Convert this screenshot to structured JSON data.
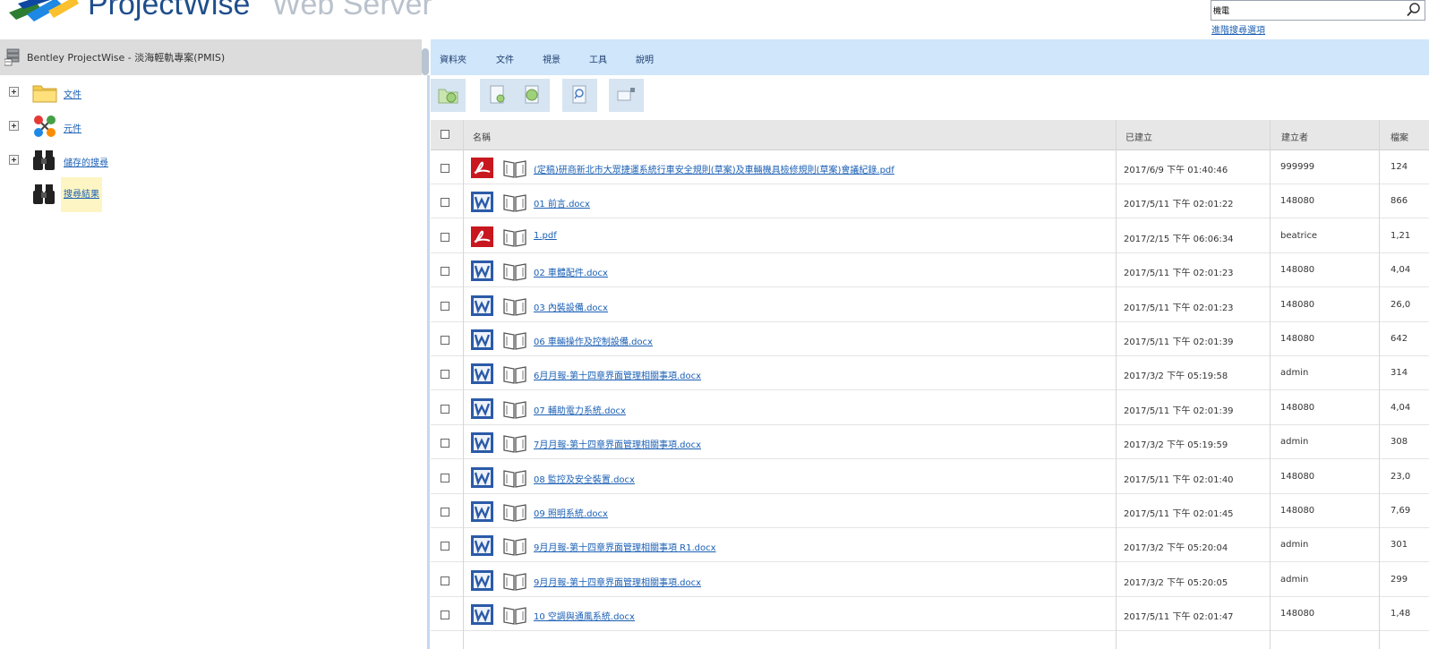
{
  "header": {
    "product_name": "ProjectWise",
    "product_sub": "Web Server",
    "search_value": "機電",
    "advanced_search_link": "進階搜尋選項",
    "icons": {
      "logo": "projectwise-logo-icon",
      "search": "magnifier-icon"
    }
  },
  "left_pane": {
    "title": "Bentley ProjectWise - 淡海輕軌專案(PMIS)",
    "tree": [
      {
        "label": "文件",
        "icon": "folder-icon",
        "expandable": true,
        "selected": false
      },
      {
        "label": "元件",
        "icon": "components-icon",
        "expandable": true,
        "selected": false
      },
      {
        "label": "儲存的搜尋",
        "icon": "binoculars-icon",
        "expandable": true,
        "selected": false
      },
      {
        "label": "搜尋結果",
        "icon": "binoculars-icon",
        "expandable": false,
        "selected": true
      }
    ]
  },
  "menu": [
    "資料夾",
    "文件",
    "視景",
    "工具",
    "說明"
  ],
  "toolbar": [
    "new-folder-icon",
    "new-document-icon",
    "add-document-icon",
    "search-document-icon",
    "open-camera-icon"
  ],
  "grid": {
    "columns": [
      "名稱",
      "已建立",
      "建立者",
      "檔案"
    ],
    "rows": [
      {
        "type": "pdf",
        "name": "(定稿)研商新北市大眾捷運系統行車安全規則(草案)及車輛機具檢修規則(草案)會議紀錄.pdf",
        "created": "2017/6/9 下午 01:40:46",
        "creator": "999999",
        "size": "124"
      },
      {
        "type": "word",
        "name": "01 前言.docx",
        "created": "2017/5/11 下午 02:01:22",
        "creator": "148080",
        "size": "866"
      },
      {
        "type": "pdf",
        "name": "1.pdf",
        "created": "2017/2/15 下午 06:06:34",
        "creator": "beatrice",
        "size": "1,21"
      },
      {
        "type": "word",
        "name": "02 車體配件.docx",
        "created": "2017/5/11 下午 02:01:23",
        "creator": "148080",
        "size": "4,04"
      },
      {
        "type": "word",
        "name": "03 內裝設備.docx",
        "created": "2017/5/11 下午 02:01:23",
        "creator": "148080",
        "size": "26,0"
      },
      {
        "type": "word",
        "name": "06 車輛操作及控制設備.docx",
        "created": "2017/5/11 下午 02:01:39",
        "creator": "148080",
        "size": "642"
      },
      {
        "type": "word",
        "name": "6月月報-第十四章界面管理相關事項.docx",
        "created": "2017/3/2 下午 05:19:58",
        "creator": "admin",
        "size": "314"
      },
      {
        "type": "word",
        "name": "07 輔助電力系統.docx",
        "created": "2017/5/11 下午 02:01:39",
        "creator": "148080",
        "size": "4,04"
      },
      {
        "type": "word",
        "name": "7月月報-第十四章界面管理相關事項.docx",
        "created": "2017/3/2 下午 05:19:59",
        "creator": "admin",
        "size": "308"
      },
      {
        "type": "word",
        "name": "08 監控及安全裝置.docx",
        "created": "2017/5/11 下午 02:01:40",
        "creator": "148080",
        "size": "23,0"
      },
      {
        "type": "word",
        "name": "09 照明系統.docx",
        "created": "2017/5/11 下午 02:01:45",
        "creator": "148080",
        "size": "7,69"
      },
      {
        "type": "word",
        "name": "9月月報-第十四章界面管理相關事項 R1.docx",
        "created": "2017/3/2 下午 05:20:04",
        "creator": "admin",
        "size": "301"
      },
      {
        "type": "word",
        "name": "9月月報-第十四章界面管理相關事項.docx",
        "created": "2017/3/2 下午 05:20:05",
        "creator": "admin",
        "size": "299"
      },
      {
        "type": "word",
        "name": "10 空調與通風系統.docx",
        "created": "2017/5/11 下午 02:01:47",
        "creator": "148080",
        "size": "1,48"
      }
    ]
  },
  "colors": {
    "brand": "#1f4e8c",
    "menubar": "#cfe6fb",
    "link": "#1a5fb4",
    "pdf": "#c8171e",
    "word": "#2b5aa8"
  }
}
